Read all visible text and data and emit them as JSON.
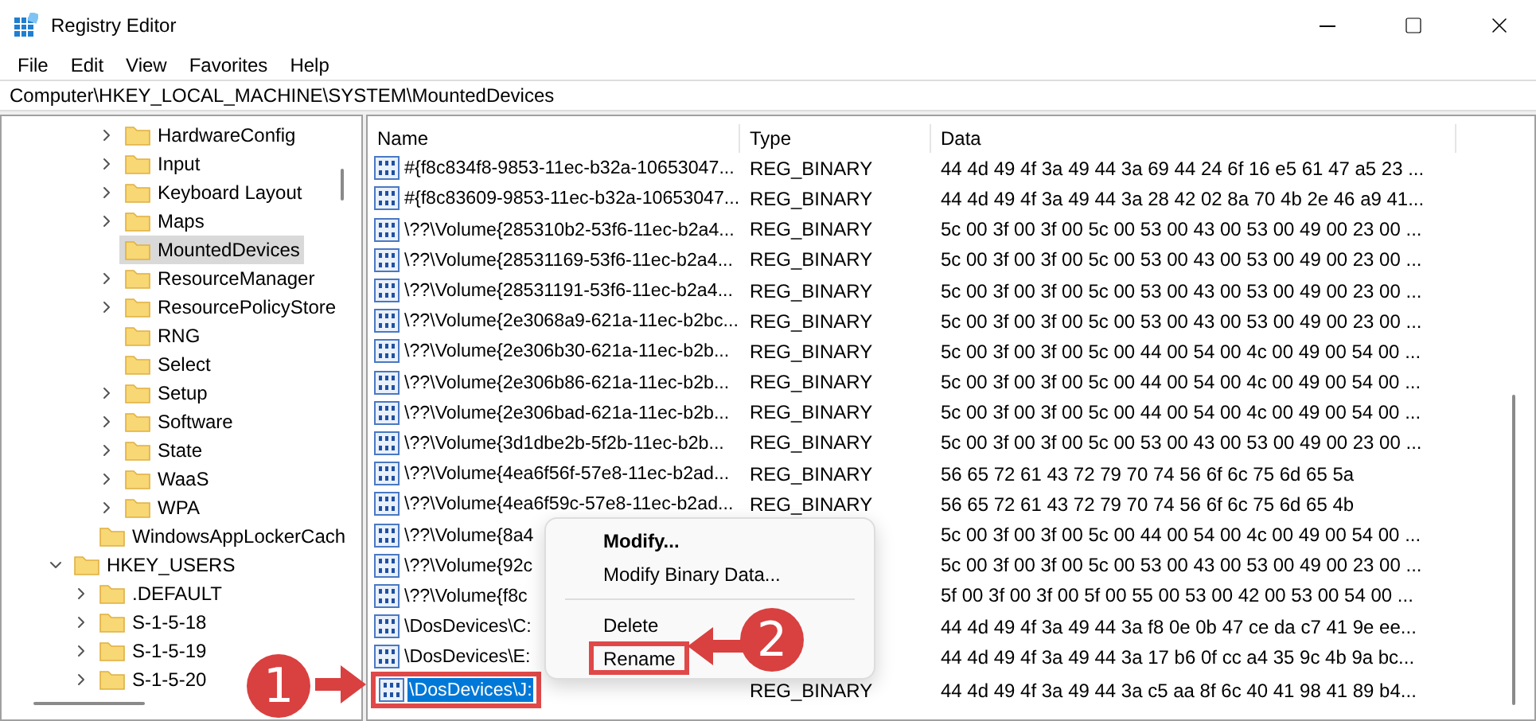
{
  "window": {
    "title": "Registry Editor"
  },
  "menu": [
    "File",
    "Edit",
    "View",
    "Favorites",
    "Help"
  ],
  "address": "Computer\\HKEY_LOCAL_MACHINE\\SYSTEM\\MountedDevices",
  "tree": [
    {
      "children": [
        {
          "children": [
            {
              "label": "HardwareConfig",
              "expandable": true,
              "selected": false
            },
            {
              "label": "Input",
              "expandable": true,
              "selected": false
            },
            {
              "label": "Keyboard Layout",
              "expandable": true,
              "selected": false
            },
            {
              "label": "Maps",
              "expandable": true,
              "selected": false
            },
            {
              "label": "MountedDevices",
              "expandable": false,
              "selected": true
            },
            {
              "label": "ResourceManager",
              "expandable": true,
              "selected": false
            },
            {
              "label": "ResourcePolicyStore",
              "expandable": true,
              "selected": false
            },
            {
              "label": "RNG",
              "expandable": false,
              "selected": false
            },
            {
              "label": "Select",
              "expandable": false,
              "selected": false
            },
            {
              "label": "Setup",
              "expandable": true,
              "selected": false
            },
            {
              "label": "Software",
              "expandable": true,
              "selected": false
            },
            {
              "label": "State",
              "expandable": true,
              "selected": false
            },
            {
              "label": "WaaS",
              "expandable": true,
              "selected": false
            },
            {
              "label": "WPA",
              "expandable": true,
              "selected": false
            }
          ]
        },
        {
          "label": "WindowsAppLockerCach",
          "expandable": false,
          "selected": false
        }
      ]
    },
    {
      "label": "HKEY_USERS",
      "expandable": true,
      "expanded": true,
      "selected": false,
      "children": [
        {
          "label": ".DEFAULT",
          "expandable": true,
          "selected": false
        },
        {
          "label": "S-1-5-18",
          "expandable": true,
          "selected": false
        },
        {
          "label": "S-1-5-19",
          "expandable": true,
          "selected": false
        },
        {
          "label": "S-1-5-20",
          "expandable": true,
          "selected": false
        }
      ]
    }
  ],
  "table": {
    "columns": [
      "Name",
      "Type",
      "Data"
    ],
    "rows": [
      {
        "name": "#{f8c834f8-9853-11ec-b32a-10653047...",
        "type": "REG_BINARY",
        "data": "44 4d 49 4f 3a 49 44 3a 69 44 24 6f 16 e5 61 47 a5 23 ...",
        "selected": false
      },
      {
        "name": "#{f8c83609-9853-11ec-b32a-10653047...",
        "type": "REG_BINARY",
        "data": "44 4d 49 4f 3a 49 44 3a 28 42 02 8a 70 4b 2e 46 a9 41...",
        "selected": false
      },
      {
        "name": "\\??\\Volume{285310b2-53f6-11ec-b2a4...",
        "type": "REG_BINARY",
        "data": "5c 00 3f 00 3f 00 5c 00 53 00 43 00 53 00 49 00 23 00 ...",
        "selected": false
      },
      {
        "name": "\\??\\Volume{28531169-53f6-11ec-b2a4...",
        "type": "REG_BINARY",
        "data": "5c 00 3f 00 3f 00 5c 00 53 00 43 00 53 00 49 00 23 00 ...",
        "selected": false
      },
      {
        "name": "\\??\\Volume{28531191-53f6-11ec-b2a4...",
        "type": "REG_BINARY",
        "data": "5c 00 3f 00 3f 00 5c 00 53 00 43 00 53 00 49 00 23 00 ...",
        "selected": false
      },
      {
        "name": "\\??\\Volume{2e3068a9-621a-11ec-b2bc...",
        "type": "REG_BINARY",
        "data": "5c 00 3f 00 3f 00 5c 00 53 00 43 00 53 00 49 00 23 00 ...",
        "selected": false
      },
      {
        "name": "\\??\\Volume{2e306b30-621a-11ec-b2b...",
        "type": "REG_BINARY",
        "data": "5c 00 3f 00 3f 00 5c 00 44 00 54 00 4c 00 49 00 54 00 ...",
        "selected": false
      },
      {
        "name": "\\??\\Volume{2e306b86-621a-11ec-b2b...",
        "type": "REG_BINARY",
        "data": "5c 00 3f 00 3f 00 5c 00 44 00 54 00 4c 00 49 00 54 00 ...",
        "selected": false
      },
      {
        "name": "\\??\\Volume{2e306bad-621a-11ec-b2b...",
        "type": "REG_BINARY",
        "data": "5c 00 3f 00 3f 00 5c 00 44 00 54 00 4c 00 49 00 54 00 ...",
        "selected": false
      },
      {
        "name": "\\??\\Volume{3d1dbe2b-5f2b-11ec-b2b...",
        "type": "REG_BINARY",
        "data": "5c 00 3f 00 3f 00 5c 00 53 00 43 00 53 00 49 00 23 00 ...",
        "selected": false
      },
      {
        "name": "\\??\\Volume{4ea6f56f-57e8-11ec-b2ad...",
        "type": "REG_BINARY",
        "data": "56 65 72 61 43 72 79 70 74 56 6f 6c 75 6d 65 5a",
        "selected": false
      },
      {
        "name": "\\??\\Volume{4ea6f59c-57e8-11ec-b2ad...",
        "type": "REG_BINARY",
        "data": "56 65 72 61 43 72 79 70 74 56 6f 6c 75 6d 65 4b",
        "selected": false
      },
      {
        "name": "\\??\\Volume{8a4",
        "data": "5c 00 3f 00 3f 00 5c 00 44 00 54 00 4c 00 49 00 54 00 ...",
        "selected": false
      },
      {
        "name": "\\??\\Volume{92c",
        "data": "5c 00 3f 00 3f 00 5c 00 53 00 43 00 53 00 49 00 23 00 ...",
        "selected": false
      },
      {
        "name": "\\??\\Volume{f8c",
        "data": "5f 00 3f 00 3f 00 5f 00 55 00 53 00 42 00 53 00 54 00 ...",
        "selected": false
      },
      {
        "name": "\\DosDevices\\C:",
        "data": "44 4d 49 4f 3a 49 44 3a f8 0e 0b 47 ce da c7 41 9e ee...",
        "selected": false
      },
      {
        "name": "\\DosDevices\\E:",
        "data": "44 4d 49 4f 3a 49 44 3a 17 b6 0f cc a4 35 9c 4b 9a bc...",
        "selected": false
      },
      {
        "name": "\\DosDevices\\J:",
        "type": "REG_BINARY",
        "data": "44 4d 49 4f 3a 49 44 3a c5 aa 8f 6c 40 41 98 41 89 b4...",
        "selected": true,
        "highlighted": true
      }
    ]
  },
  "context_menu": [
    {
      "kind": "item",
      "label": "Modify...",
      "bold": true,
      "highlighted": false
    },
    {
      "kind": "item",
      "label": "Modify Binary Data...",
      "bold": false,
      "highlighted": false
    },
    {
      "kind": "separator"
    },
    {
      "kind": "item",
      "label": "Delete",
      "bold": false,
      "highlighted": false
    },
    {
      "kind": "item",
      "label": "Rename",
      "bold": false,
      "highlighted": true
    }
  ],
  "annotations": [
    "1",
    "2"
  ]
}
